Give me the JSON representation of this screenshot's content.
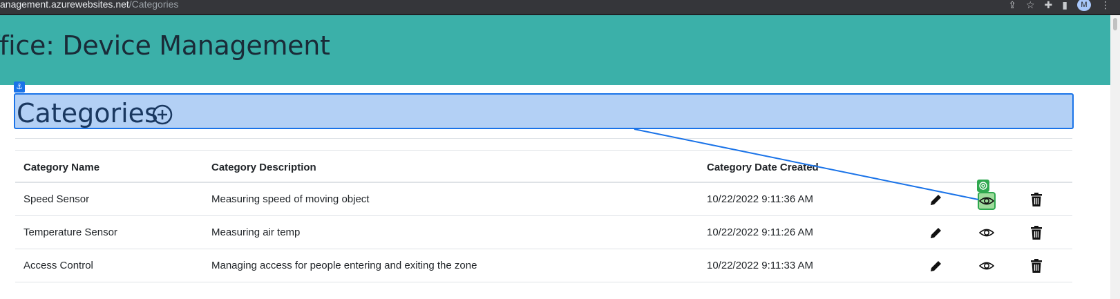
{
  "browser": {
    "url_host": "anagement.azurewebsites.net",
    "url_path": "/Categories",
    "profile_initial": "M"
  },
  "header": {
    "title": "ffice: Device Management"
  },
  "page": {
    "title": "Categories",
    "table": {
      "columns": [
        "Category Name",
        "Category Description",
        "Category Date Created"
      ],
      "rows": [
        {
          "name": "Speed Sensor",
          "description": "Measuring speed of moving object",
          "created": "10/22/2022 9:11:36 AM"
        },
        {
          "name": "Temperature Sensor",
          "description": "Measuring air temp",
          "created": "10/22/2022 9:11:26 AM"
        },
        {
          "name": "Access Control",
          "description": "Managing access for people entering and exiting the zone",
          "created": "10/22/2022 9:11:33 AM"
        }
      ]
    }
  },
  "icons": {
    "add": "plus-circle-icon",
    "edit": "pencil-icon",
    "view": "eye-icon",
    "delete": "trash-icon",
    "anchor": "anchor-icon"
  },
  "colors": {
    "header_bg": "#3bb0a9",
    "highlight_bg": "#b3d0f5",
    "highlight_border": "#1a73e8",
    "focus_green": "#2fa84f"
  }
}
